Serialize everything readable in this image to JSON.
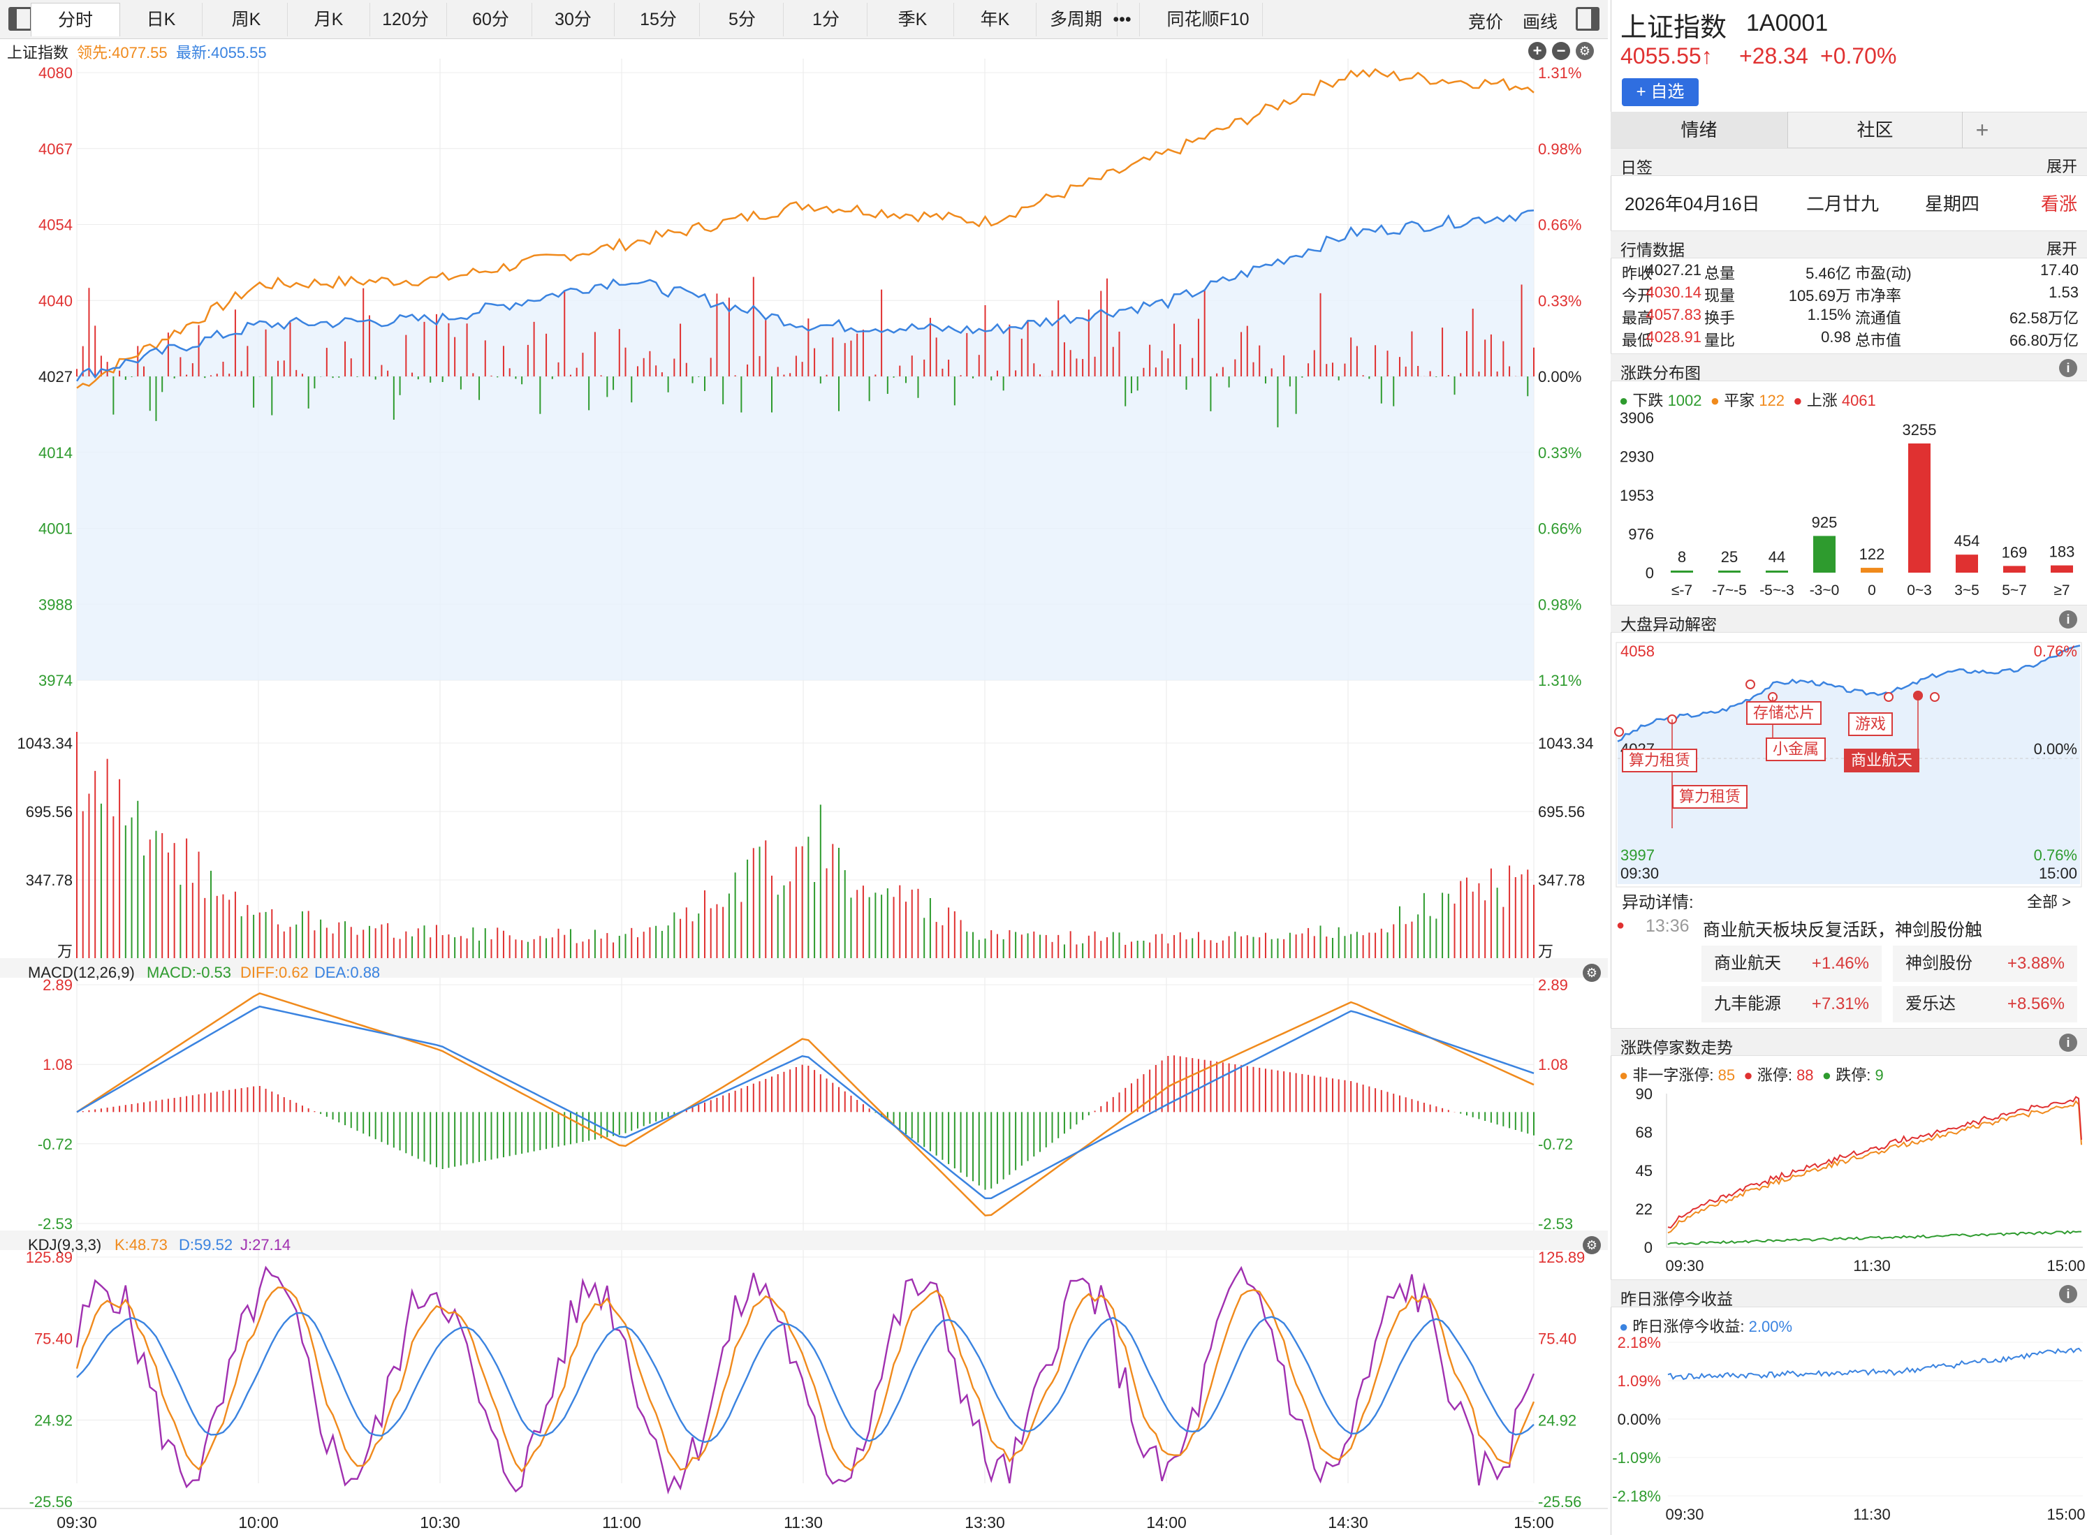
{
  "toolbar": {
    "tabs": [
      "分时",
      "日K",
      "周K",
      "月K",
      "120分",
      "60分",
      "30分",
      "15分",
      "5分",
      "1分",
      "季K",
      "年K",
      "多周期",
      "•••",
      "同花顺F10"
    ],
    "active": "分时",
    "right": [
      "竞价",
      "画线"
    ]
  },
  "main": {
    "symbol": "上证指数",
    "lead_label": "领先:4077.55",
    "latest_label": "最新:4055.55",
    "price_left": [
      "4080",
      "4067",
      "4054",
      "4040",
      "4027",
      "4014",
      "4001",
      "3988",
      "3974"
    ],
    "price_right": [
      "1.31%",
      "0.98%",
      "0.66%",
      "0.33%",
      "0.00%",
      "0.33%",
      "0.66%",
      "0.98%",
      "1.31%"
    ],
    "vol_left": [
      "1043.34",
      "695.56",
      "347.78",
      "万"
    ],
    "vol_right": [
      "1043.34",
      "695.56",
      "347.78",
      "万"
    ],
    "macd": {
      "title": "MACD(12,26,9)",
      "macd": "MACD:-0.53",
      "diff": "DIFF:0.62",
      "dea": "DEA:0.88",
      "ticks": [
        "2.89",
        "1.08",
        "-0.72",
        "-2.53"
      ]
    },
    "kdj": {
      "title": "KDJ(9,3,3)",
      "k": "K:48.73",
      "d": "D:59.52",
      "j": "J:27.14",
      "ticks": [
        "125.89",
        "75.40",
        "24.92",
        "-25.56"
      ]
    },
    "time_axis": [
      "09:30",
      "10:00",
      "10:30",
      "11:00",
      "11:30",
      "13:30",
      "14:00",
      "14:30",
      "15:00"
    ]
  },
  "chart_data": [
    {
      "type": "line",
      "title": "上证指数 分时",
      "x": [
        "09:30",
        "10:00",
        "10:30",
        "11:00",
        "11:30",
        "13:30",
        "14:00",
        "14:30",
        "15:00"
      ],
      "ylim": [
        3974,
        4080
      ],
      "series": [
        {
          "name": "领先",
          "values": [
            4025,
            4043,
            4044,
            4050,
            4057,
            4054,
            4066,
            4080,
            4077.55
          ]
        },
        {
          "name": "最新",
          "values": [
            4027,
            4036,
            4037,
            4044,
            4036,
            4035,
            4040,
            4052,
            4055.55
          ]
        }
      ]
    },
    {
      "type": "bar",
      "title": "成交量",
      "x": [
        "09:30",
        "10:00",
        "10:30",
        "11:00",
        "11:30",
        "13:30",
        "14:00",
        "14:30",
        "15:00"
      ],
      "ylim": [
        0,
        1043.34
      ],
      "series": [
        {
          "name": "成交量",
          "values": [
            980,
            230,
            140,
            120,
            610,
            120,
            110,
            150,
            470
          ]
        }
      ]
    },
    {
      "type": "line",
      "title": "MACD(12,26,9)",
      "x": [
        "09:30",
        "10:00",
        "10:30",
        "11:00",
        "11:30",
        "13:30",
        "14:00",
        "14:30",
        "15:00"
      ],
      "ylim": [
        -2.53,
        2.89
      ],
      "series": [
        {
          "name": "DIFF",
          "values": [
            0,
            2.7,
            1.4,
            -0.8,
            1.7,
            -2.4,
            0.6,
            2.5,
            0.62
          ]
        },
        {
          "name": "DEA",
          "values": [
            0,
            2.4,
            1.5,
            -0.6,
            1.3,
            -2.0,
            0.2,
            2.3,
            0.88
          ]
        },
        {
          "name": "MACD",
          "values": [
            0,
            0.6,
            -1.3,
            -0.5,
            1.1,
            -1.8,
            1.3,
            0.7,
            -0.53
          ]
        }
      ]
    },
    {
      "type": "line",
      "title": "KDJ(9,3,3)",
      "x": [
        "09:30",
        "10:00",
        "10:30",
        "11:00",
        "11:30",
        "13:30",
        "14:00",
        "14:30",
        "15:00"
      ],
      "ylim": [
        -25.56,
        125.89
      ],
      "series": [
        {
          "name": "K",
          "values": [
            60,
            110,
            50,
            95,
            30,
            70,
            100,
            40,
            48.73
          ]
        },
        {
          "name": "D",
          "values": [
            60,
            95,
            55,
            85,
            40,
            65,
            90,
            50,
            59.52
          ]
        },
        {
          "name": "J",
          "values": [
            60,
            125,
            30,
            115,
            10,
            80,
            120,
            20,
            27.14
          ]
        }
      ]
    },
    {
      "type": "bar",
      "title": "涨跌分布图",
      "categories": [
        "≤-7",
        "-7~-5",
        "-5~-3",
        "-3~0",
        "0",
        "0~3",
        "3~5",
        "5~7",
        "≥7"
      ],
      "values": [
        8,
        25,
        44,
        925,
        122,
        3255,
        454,
        169,
        183
      ],
      "ylim": [
        0,
        3906
      ]
    },
    {
      "type": "line",
      "title": "涨跌停家数走势",
      "x": [
        "09:30",
        "11:30",
        "15:00"
      ],
      "ylim": [
        0,
        90
      ],
      "series": [
        {
          "name": "非一字涨停",
          "values": [
            5,
            60,
            85
          ]
        },
        {
          "name": "涨停",
          "values": [
            5,
            62,
            88
          ]
        },
        {
          "name": "跌停",
          "values": [
            2,
            5,
            9
          ]
        }
      ]
    },
    {
      "type": "line",
      "title": "昨日涨停今收益",
      "x": [
        "09:30",
        "11:30",
        "15:00"
      ],
      "ylim": [
        -2.18,
        2.18
      ],
      "series": [
        {
          "name": "昨日涨停今收益",
          "values": [
            1.2,
            1.3,
            2.0
          ]
        }
      ]
    }
  ],
  "right": {
    "name": "上证指数",
    "code": "1A0001",
    "price": "4055.55↑",
    "change": "+28.34",
    "pct": "+0.70%",
    "add_btn": "+ 自选",
    "tabs": [
      "情绪",
      "社区",
      "+"
    ],
    "calendar": {
      "title": "日签",
      "expand": "展开",
      "date": "2026年04月16日",
      "lunar": "二月廿九",
      "weekday": "星期四",
      "mood": "看涨"
    },
    "quote": {
      "title": "行情数据",
      "expand": "展开",
      "rows": [
        [
          "昨收",
          "4027.21",
          "总量",
          "5.46亿",
          "市盈(动)",
          "17.40"
        ],
        [
          "今开",
          "4030.14",
          "现量",
          "105.69万",
          "市净率",
          "1.53"
        ],
        [
          "最高",
          "4057.83",
          "换手",
          "1.15%",
          "流通值",
          "62.58万亿"
        ],
        [
          "最低",
          "4028.91",
          "量比",
          "0.98",
          "总市值",
          "66.80万亿"
        ]
      ]
    },
    "dist": {
      "title": "涨跌分布图",
      "legend_down": "下跌",
      "down": "1002",
      "legend_flat": "平家",
      "flat": "122",
      "legend_up": "上涨",
      "up": "4061",
      "yticks": [
        "3906",
        "2930",
        "1953",
        "976",
        "0"
      ]
    },
    "anomaly": {
      "title": "大盘异动解密",
      "ytop": "4058",
      "ymid": "4027",
      "ybot": "3997",
      "rtop": "0.76%",
      "rmid": "0.00%",
      "rbot": "0.76%",
      "t0": "09:30",
      "t1": "15:00",
      "tags": [
        "算力租赁",
        "算力租赁",
        "存储芯片",
        "小金属",
        "游戏",
        "商业航天"
      ],
      "detail_label": "异动详情:",
      "all": "全部 >",
      "time": "13:36",
      "headline": "商业航天板块反复活跃，神剑股份触",
      "cells": [
        [
          "商业航天",
          "+1.46%"
        ],
        [
          "神剑股份",
          "+3.88%"
        ],
        [
          "九丰能源",
          "+7.31%"
        ],
        [
          "爱乐达",
          "+8.56%"
        ]
      ]
    },
    "limit": {
      "title": "涨跌停家数走势",
      "l1": "非一字涨停:",
      "v1": "85",
      "l2": "涨停:",
      "v2": "88",
      "l3": "跌停:",
      "v3": "9",
      "yticks": [
        "90",
        "68",
        "45",
        "22",
        "0"
      ],
      "t": [
        "09:30",
        "11:30",
        "15:00"
      ]
    },
    "yday": {
      "title": "昨日涨停今收益",
      "label": "昨日涨停今收益:",
      "value": "2.00%",
      "yticks": [
        "2.18%",
        "1.09%",
        "0.00%",
        "-1.09%",
        "-2.18%"
      ],
      "t": [
        "09:30",
        "11:30",
        "15:00"
      ]
    }
  },
  "colors": {
    "up": "#e03131",
    "down": "#2e9b2e",
    "lead": "#f08a1c",
    "latest": "#3a83e0",
    "j": "#a030b0"
  }
}
